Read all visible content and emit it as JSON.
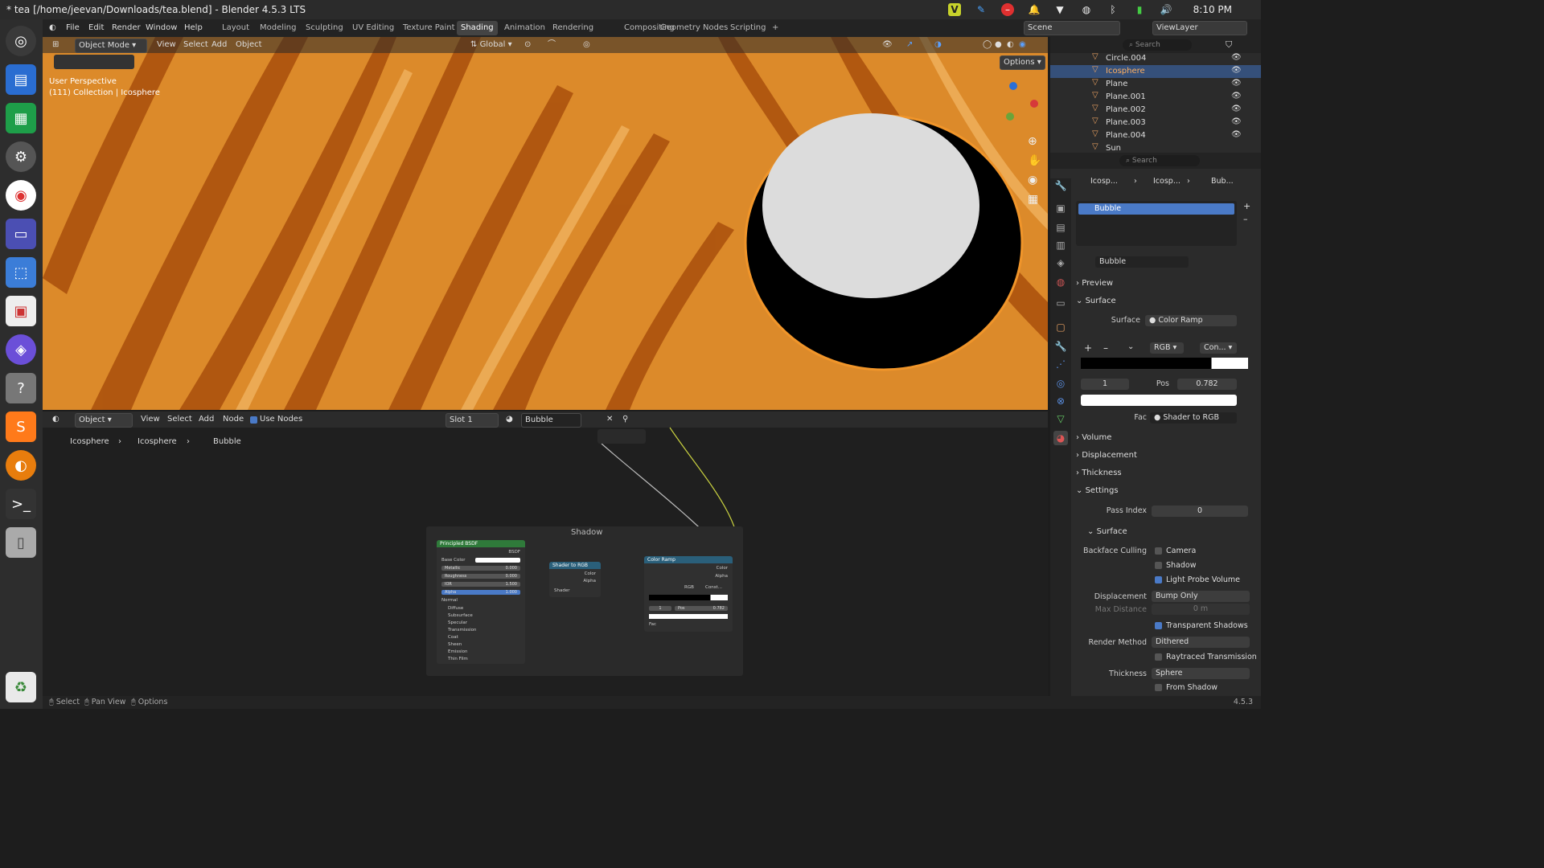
{
  "window": {
    "title": "* tea [/home/jeevan/Downloads/tea.blend] - Blender 4.5.3 LTS",
    "clock": "8:10 PM"
  },
  "menu": {
    "file": "File",
    "edit": "Edit",
    "render": "Render",
    "window": "Window",
    "help": "Help"
  },
  "workspaces": [
    "Layout",
    "Modeling",
    "Sculpting",
    "UV Editing",
    "Texture Paint",
    "Shading",
    "Animation",
    "Rendering",
    "Compositing",
    "Geometry Nodes",
    "Scripting"
  ],
  "active_workspace": "Shading",
  "scene": {
    "name": "Scene",
    "view_layer": "ViewLayer"
  },
  "viewport": {
    "mode": "Object Mode",
    "view": "View",
    "select": "Select",
    "add": "Add",
    "object": "Object",
    "orientation": "Global",
    "options": "Options",
    "perspective": "User Perspective",
    "collection_info": "(111) Collection | Icosphere"
  },
  "outliner": {
    "search_placeholder": "Search",
    "items": [
      "Circle.004",
      "Icosphere",
      "Plane",
      "Plane.001",
      "Plane.002",
      "Plane.003",
      "Plane.004",
      "Sun"
    ],
    "selected": "Icosphere"
  },
  "properties": {
    "search_placeholder": "Search",
    "breadcrumb": [
      "Icosp...",
      "Icosp...",
      "Bub..."
    ],
    "material_slot": "Bubble",
    "material_name": "Bubble",
    "panels": {
      "preview": "Preview",
      "surface": "Surface",
      "volume": "Volume",
      "displacement": "Displacement",
      "thickness": "Thickness",
      "settings": "Settings",
      "surface_sub": "Surface"
    },
    "surface_label": "Surface",
    "surface_value": "Color Ramp",
    "ramp": {
      "mode": "RGB",
      "interp": "Con...",
      "index": "1",
      "pos_label": "Pos",
      "pos": "0.782"
    },
    "fac_label": "Fac",
    "fac_value": "Shader to RGB",
    "pass_index_label": "Pass Index",
    "pass_index": "0",
    "backface_label": "Backface Culling",
    "camera": "Camera",
    "shadow": "Shadow",
    "light_probe": "Light Probe Volume",
    "displacement_label": "Displacement",
    "displacement_value": "Bump Only",
    "max_distance_label": "Max Distance",
    "max_distance": "0 m",
    "transparent_shadows": "Transparent Shadows",
    "render_method_label": "Render Method",
    "render_method": "Dithered",
    "raytraced": "Raytraced Transmission",
    "thickness_label": "Thickness",
    "thickness_value": "Sphere",
    "from_shadow": "From Shadow"
  },
  "node_editor": {
    "type": "Object",
    "view": "View",
    "select": "Select",
    "add": "Add",
    "node": "Node",
    "use_nodes": "Use Nodes",
    "slot": "Slot 1",
    "material": "Bubble",
    "breadcrumb": [
      "Icosphere",
      "Icosphere",
      "Bubble"
    ],
    "frame_label": "Shadow",
    "bsdf": {
      "title": "Principled BSDF",
      "out": "BSDF",
      "base_color": "Base Color",
      "metallic": "Metallic",
      "metallic_v": "0.000",
      "roughness": "Roughness",
      "roughness_v": "0.000",
      "ior": "IOR",
      "ior_v": "1.500",
      "alpha": "Alpha",
      "alpha_v": "1.000",
      "normal": "Normal",
      "subs": [
        "Diffuse",
        "Subsurface",
        "Specular",
        "Transmission",
        "Coat",
        "Sheen",
        "Emission",
        "Thin Film"
      ]
    },
    "s2rgb": {
      "title": "Shader to RGB",
      "color": "Color",
      "alpha": "Alpha",
      "shader": "Shader"
    },
    "ramp": {
      "title": "Color Ramp",
      "color": "Color",
      "alpha": "Alpha",
      "mode": "RGB",
      "interp": "Const...",
      "index": "1",
      "pos": "Pos",
      "pos_v": "0.782",
      "fac": "Fac"
    }
  },
  "status": {
    "select": "Select",
    "pan": "Pan View",
    "options": "Options",
    "version": "4.5.3"
  }
}
